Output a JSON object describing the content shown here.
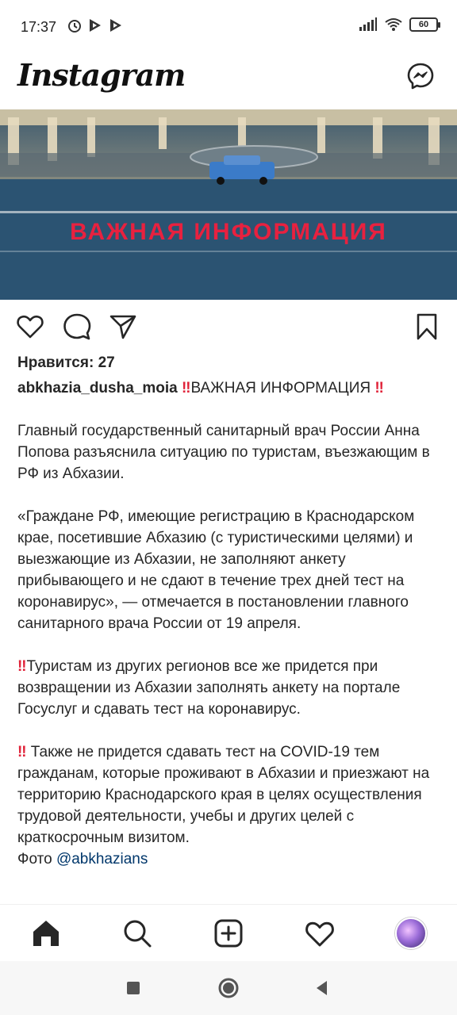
{
  "status_bar": {
    "time": "17:37",
    "battery": "60",
    "icons": [
      "alarm-icon",
      "play-icon",
      "play-icon",
      "signal-icon",
      "wifi-icon",
      "battery-icon"
    ]
  },
  "header": {
    "logo": "Instagram",
    "messenger_icon": "messenger-icon"
  },
  "post": {
    "image_text": "ВАЖНАЯ ИНФОРМАЦИЯ",
    "likes": "Нравится: 27",
    "username": "abkhazia_dusha_moia",
    "title_excl": "‼️",
    "title": "ВАЖНАЯ ИНФОРМАЦИЯ",
    "paragraphs": [
      "Главный государственный санитарный врач России Анна Попова разъяснила ситуацию по туристам, въезжающим в РФ из Абхазии.",
      "«Граждане РФ, имеющие регистрацию в Краснодарском крае, посетившие Абхазию (с туристическими целями) и выезжающие из Абхазии, не заполняют анкету прибывающего и не сдают в течение трех дней тест на коронавирус», — отмечается в постановлении главного санитарного врача России от 19 апреля.",
      "Туристам из других регионов все же придется при возвращении из Абхазии заполнять анкету на портале Госуслуг и сдавать тест на коронавирус.",
      " Также не придется сдавать тест на COVID-19 тем гражданам, которые проживают в Абхазии и приезжают на территорию Краснодарского края в целях осуществления трудовой деятельности, учебы и других целей с краткосрочным визитом."
    ],
    "photo_label": "Фото",
    "photo_mention": "@abkhazians"
  },
  "bottom_nav": [
    "home-icon",
    "search-icon",
    "new-post-icon",
    "activity-icon",
    "profile-avatar"
  ],
  "system_nav": [
    "recents-icon",
    "home-circle-icon",
    "back-icon"
  ]
}
